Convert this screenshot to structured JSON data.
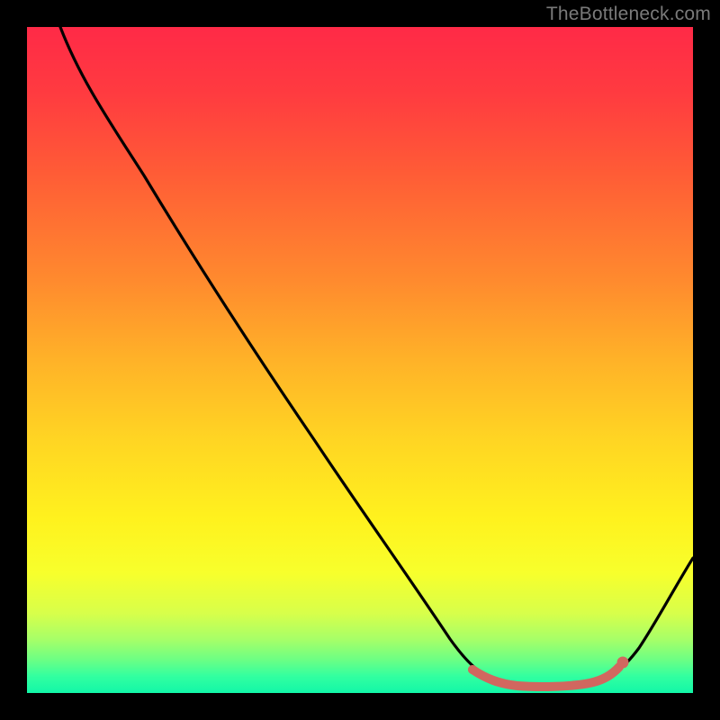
{
  "watermark": "TheBottleneck.com",
  "colors": {
    "bg_black": "#000000",
    "gradient_top": "#ff2a47",
    "gradient_bottom": "#12f7a8",
    "curve_stroke": "#000000",
    "marker_fill": "#d1675f",
    "marker_stroke": "#d1675f"
  },
  "chart_data": {
    "type": "line",
    "title": "",
    "xlabel": "",
    "ylabel": "",
    "xlim": [
      0,
      100
    ],
    "ylim": [
      0,
      100
    ],
    "x": [
      5,
      10,
      15,
      20,
      25,
      30,
      35,
      40,
      45,
      50,
      55,
      60,
      63,
      65,
      68,
      70,
      72,
      75,
      78,
      80,
      82,
      84,
      86,
      90,
      95,
      100
    ],
    "y": [
      100,
      94,
      87,
      80,
      72,
      64,
      56,
      48,
      40,
      32,
      24,
      16,
      10,
      7,
      4,
      2.3,
      1.6,
      1.1,
      0.9,
      0.9,
      0.9,
      1.2,
      1.8,
      4.5,
      10,
      18
    ],
    "optimal_region": {
      "x": [
        68,
        70,
        72,
        74,
        76,
        78,
        80,
        82,
        84,
        86
      ],
      "y": [
        3.8,
        2.3,
        1.6,
        1.2,
        1.05,
        0.9,
        0.9,
        0.9,
        1.2,
        1.8
      ]
    }
  }
}
